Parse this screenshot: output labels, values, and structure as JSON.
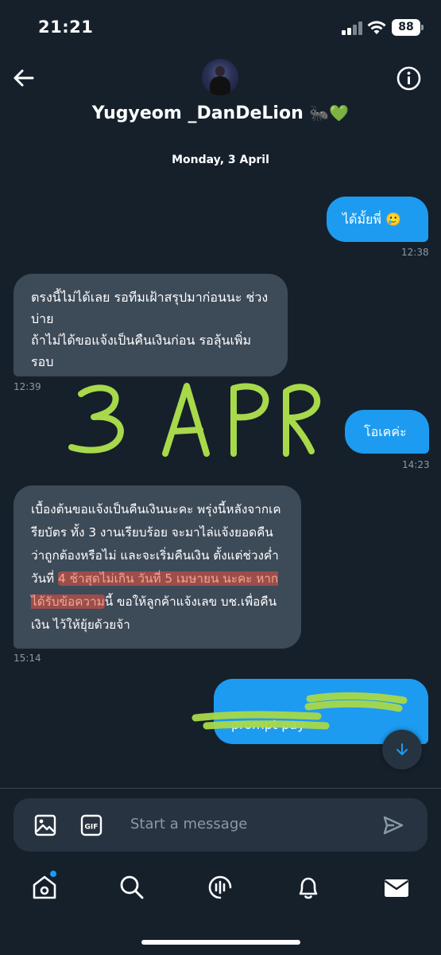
{
  "status_bar": {
    "time": "21:21",
    "battery": "88"
  },
  "header": {
    "name": "Yugyeom _DanDeLion",
    "name_emoji": "🐜💚"
  },
  "date_divider": "Monday, 3 April",
  "messages": [
    {
      "side": "sent",
      "text": "ได้มั้ยพี่ 🥲",
      "time": "12:38"
    },
    {
      "side": "received",
      "text": "ตรงนี้ไม่ได้เลย รอทีมเฝ้าสรุปมาก่อนนะ ช่วงบ่าย\nถ้าไม่ได้ขอแจ้งเป็นคืนเงินก่อน รอลุ้นเพิ่มรอบ",
      "time": "12:39"
    },
    {
      "side": "sent",
      "text": "โอเคค่ะ",
      "time": "14:23"
    },
    {
      "side": "received",
      "time": "15:14",
      "part1": "เบื้องต้นขอแจ้งเป็นคืนเงินนะคะ พรุ่งนี้หลังจากเครียบัตร ทั้ง 3 งานเรียบร้อย จะมาไล่แจ้งยอดคืน ว่าถูกต้องหรือไม่ และจะเริ่มคืนเงิน ตั้งแต่ช่วงค่ำวันที่ ",
      "highlight": "4 ช้าสุดไม่เกิน วันที่ 5 เมษายน นะคะ หากได้รับข้อความ",
      "part2": "นี้ ขอให้ลูกค้าแจ้งเลข บช.เพื่อคืนเงิน ไว้ให้ยุ้ยด้วยจ้า"
    },
    {
      "side": "sent",
      "text": "prompt pay"
    }
  ],
  "composer": {
    "placeholder": "Start a message"
  },
  "colors": {
    "background": "#15202b",
    "sent_bubble": "#1d9bf0",
    "received_bubble": "#3d4a58",
    "scribble": "#a8d94a"
  }
}
